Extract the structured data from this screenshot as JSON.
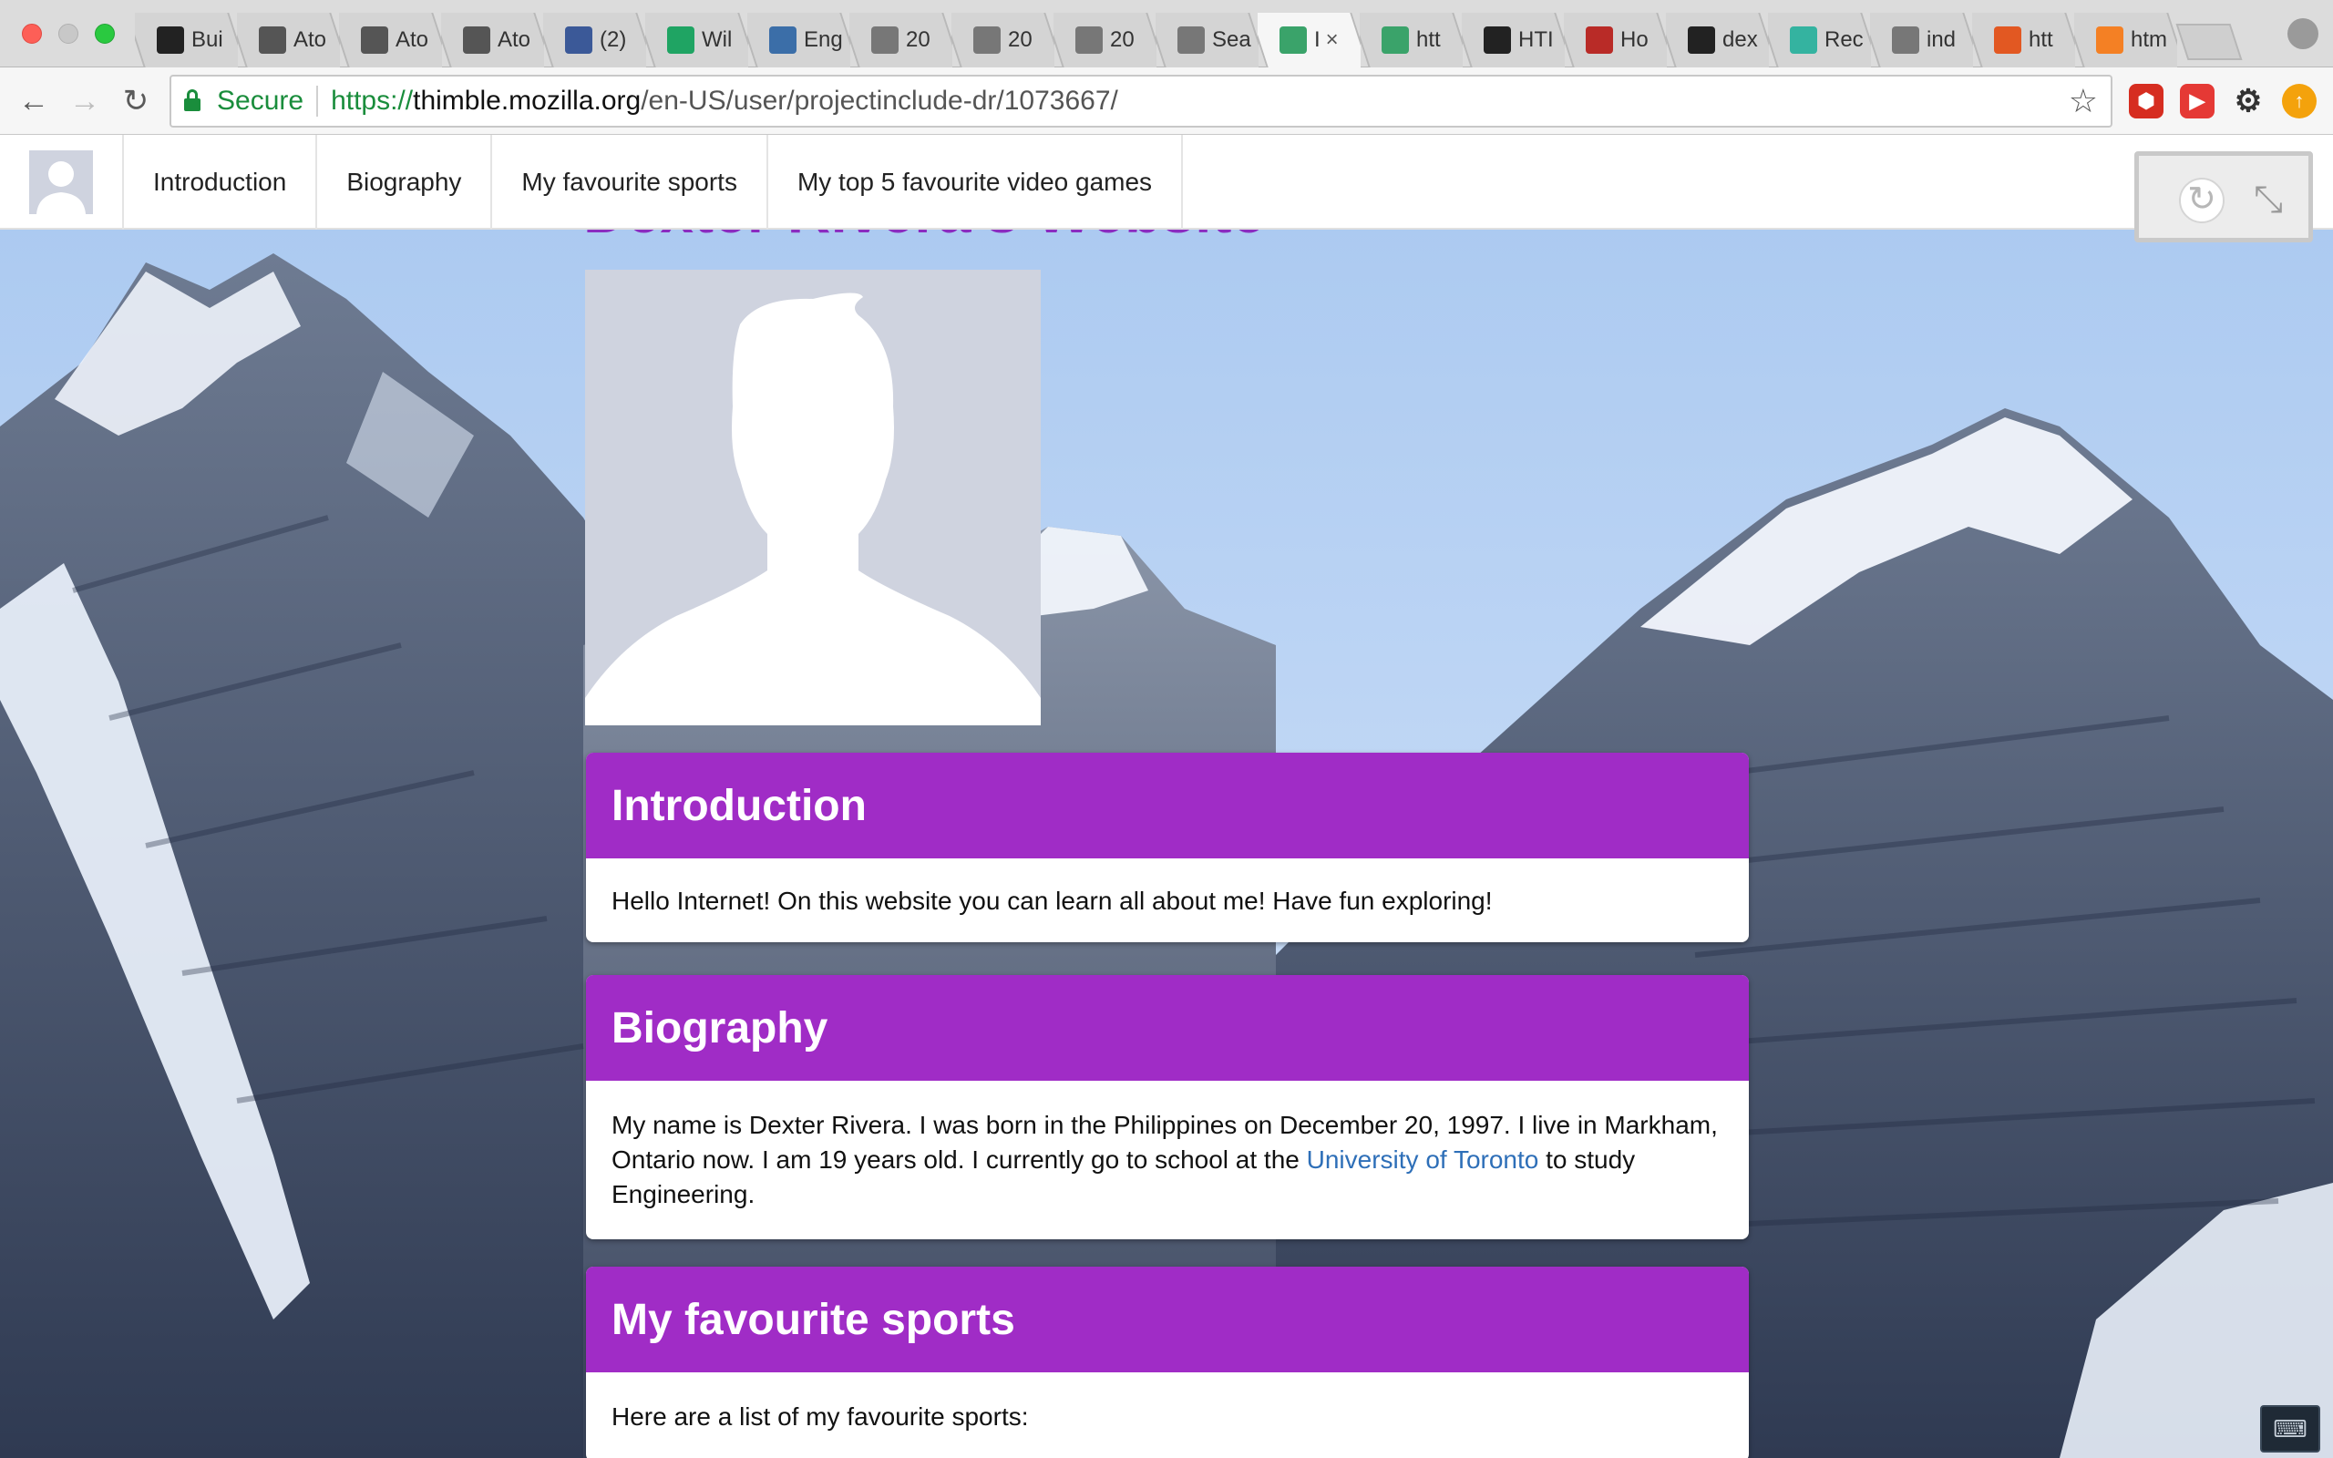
{
  "browser": {
    "tabs": [
      {
        "label": "Bui",
        "icon": "github-icon",
        "color": "#222222"
      },
      {
        "label": "Ato",
        "icon": "atom-icon",
        "color": "#555555"
      },
      {
        "label": "Ato",
        "icon": "atom-icon",
        "color": "#555555"
      },
      {
        "label": "Ato",
        "icon": "atom-icon",
        "color": "#555555"
      },
      {
        "label": "(2)",
        "icon": "facebook-icon",
        "color": "#3b5998"
      },
      {
        "label": "Wil",
        "icon": "google-drive-icon",
        "color": "#1fa463"
      },
      {
        "label": "Eng",
        "icon": "tree-icon",
        "color": "#3b6ea8"
      },
      {
        "label": "20",
        "icon": "document-icon",
        "color": "#777777"
      },
      {
        "label": "20",
        "icon": "document-icon",
        "color": "#777777"
      },
      {
        "label": "20",
        "icon": "document-icon",
        "color": "#777777"
      },
      {
        "label": "Sea",
        "icon": "document-icon",
        "color": "#777777"
      },
      {
        "label": "I",
        "icon": "thimble-icon",
        "color": "#3aa36a",
        "active": true
      },
      {
        "label": "htt",
        "icon": "thimble-icon",
        "color": "#3aa36a"
      },
      {
        "label": "HTI",
        "icon": "github-icon",
        "color": "#222222"
      },
      {
        "label": "Ho",
        "icon": "quora-icon",
        "color": "#b92b27"
      },
      {
        "label": "dex",
        "icon": "github-icon",
        "color": "#222222"
      },
      {
        "label": "Rec",
        "icon": "s-icon",
        "color": "#34b3a0"
      },
      {
        "label": "ind",
        "icon": "document-icon",
        "color": "#777777"
      },
      {
        "label": "htt",
        "icon": "shield-icon",
        "color": "#e25822"
      },
      {
        "label": "htm",
        "icon": "stackoverflow-icon",
        "color": "#f48024"
      }
    ],
    "active_tab_close": "×",
    "secure_label": "Secure",
    "url_scheme": "https://",
    "url_host": "thimble.mozilla.org",
    "url_path": "/en-US/user/projectinclude-dr/1073667/"
  },
  "site": {
    "nav": [
      "Introduction",
      "Biography",
      "My favourite sports",
      "My top 5 favourite video games"
    ],
    "title": "Dexter Rivera's Website",
    "sections": [
      {
        "heading": "Introduction",
        "body": "Hello Internet! On this website you can learn all about me! Have fun exploring!"
      },
      {
        "heading": "Biography",
        "body_pre": "My name is Dexter Rivera. I was born in the Philippines on December 20, 1997. I live in Markham, Ontario now. I am 19 years old. I currently go to school at the ",
        "body_link": "University of Toronto",
        "body_post": " to study Engineering."
      },
      {
        "heading": "My favourite sports",
        "body": "Here are a list of my favourite sports:"
      }
    ]
  },
  "colors": {
    "accent": "#a02cc6",
    "title": "#8b2cc0",
    "link": "#2e6fb8",
    "secure": "#1a8d3c"
  }
}
